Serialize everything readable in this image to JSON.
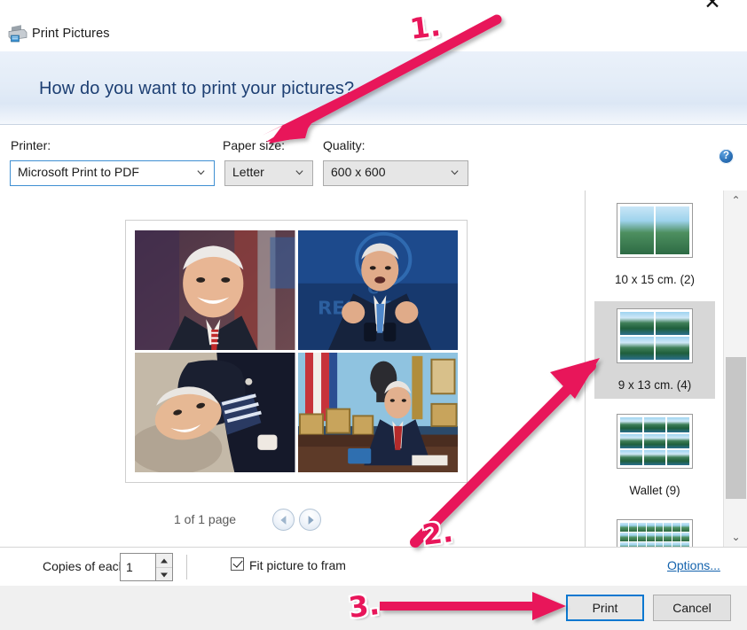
{
  "window": {
    "title": "Print Pictures",
    "icon": "printer-icon",
    "close_label": "✕"
  },
  "banner": {
    "heading": "How do you want to print your pictures?"
  },
  "toolbar": {
    "printer": {
      "label": "Printer:",
      "value": "Microsoft Print to PDF"
    },
    "paper_size": {
      "label": "Paper size:",
      "value": "Letter"
    },
    "quality": {
      "label": "Quality:",
      "value": "600 x 600"
    },
    "help_label": "?"
  },
  "preview": {
    "photos": [
      {
        "name": "photo-1",
        "alt": "Smiling portrait with flag backdrop"
      },
      {
        "name": "photo-2",
        "alt": "Speaking at podium with blue banner"
      },
      {
        "name": "photo-3",
        "alt": "Leaning portrait in dark suit"
      },
      {
        "name": "photo-4",
        "alt": "Seated at desk in the Oval Office"
      }
    ],
    "page_status": "1 of 1 page",
    "prev_label": "Previous page",
    "next_label": "Next page"
  },
  "layouts": {
    "items": [
      {
        "caption": "10 x 15 cm. (2)",
        "cols": 2,
        "rows": 1,
        "count": 2,
        "selected": false,
        "thumb_w": 86,
        "thumb_h": 62,
        "cell_class": "tall"
      },
      {
        "caption": "9 x 13 cm. (4)",
        "cols": 2,
        "rows": 2,
        "count": 4,
        "selected": true,
        "thumb_w": 86,
        "thumb_h": 62,
        "cell_class": "lake"
      },
      {
        "caption": "Wallet (9)",
        "cols": 3,
        "rows": 3,
        "count": 9,
        "selected": false,
        "thumb_w": 86,
        "thumb_h": 62,
        "cell_class": "lake"
      },
      {
        "caption": "",
        "cols": 8,
        "rows": 5,
        "count": 40,
        "selected": false,
        "thumb_w": 86,
        "thumb_h": 62,
        "cell_class": "tall"
      }
    ]
  },
  "scrollbar": {
    "up_label": "⌃",
    "down_label": "⌄"
  },
  "options": {
    "copies_label": "Copies of each",
    "copies_value": "1",
    "fit_label": "Fit picture to fram",
    "fit_checked": true,
    "options_link": "Options..."
  },
  "footer": {
    "print_label": "Print",
    "cancel_label": "Cancel"
  },
  "annotations": {
    "color": "#e8165a",
    "steps": [
      {
        "label": "1.",
        "target": "paper-size-label"
      },
      {
        "label": "2.",
        "target": "layout-9x13"
      },
      {
        "label": "3.",
        "target": "print-button"
      }
    ]
  }
}
